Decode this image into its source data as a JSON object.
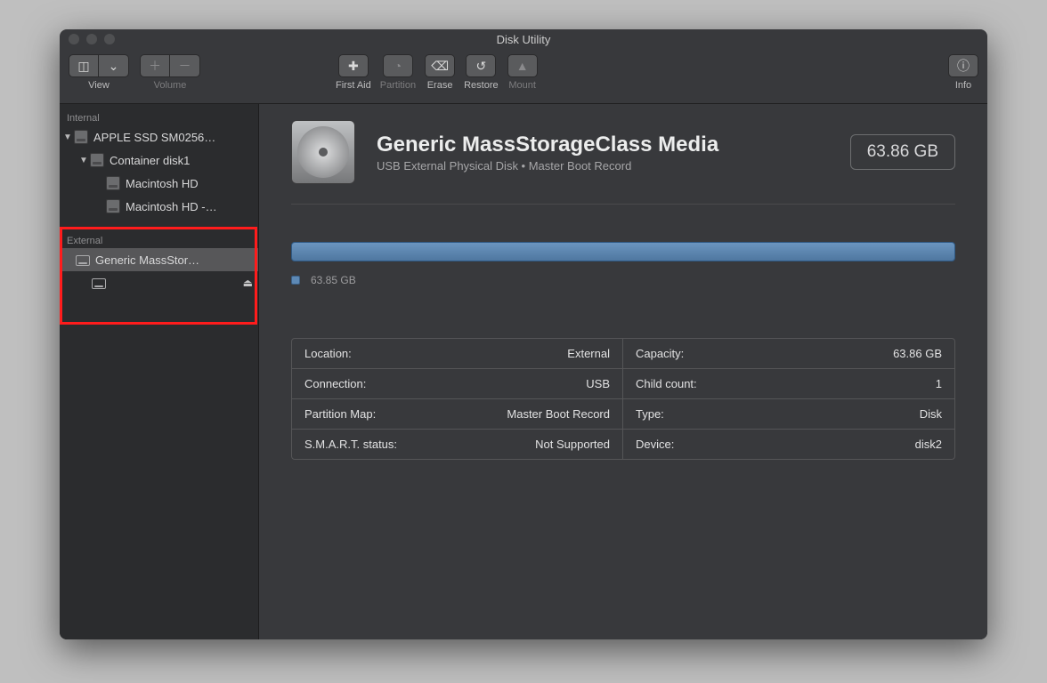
{
  "window_title": "Disk Utility",
  "toolbar": {
    "view": "View",
    "volume": "Volume",
    "first_aid": "First Aid",
    "partition": "Partition",
    "erase": "Erase",
    "restore": "Restore",
    "mount": "Mount",
    "info": "Info"
  },
  "sidebar": {
    "internal_header": "Internal",
    "internal": {
      "disk": "APPLE SSD SM0256…",
      "container": "Container disk1",
      "vol1": "Macintosh HD",
      "vol2": "Macintosh HD -…"
    },
    "external_header": "External",
    "external": {
      "disk": "Generic MassStor…",
      "vol": ""
    }
  },
  "detail": {
    "title": "Generic MassStorageClass Media",
    "subtitle": "USB External Physical Disk • Master Boot Record",
    "capacity_pill": "63.86 GB",
    "legend_size": "63.85 GB"
  },
  "info": {
    "left": [
      {
        "k": "Location:",
        "v": "External"
      },
      {
        "k": "Connection:",
        "v": "USB"
      },
      {
        "k": "Partition Map:",
        "v": "Master Boot Record"
      },
      {
        "k": "S.M.A.R.T. status:",
        "v": "Not Supported"
      }
    ],
    "right": [
      {
        "k": "Capacity:",
        "v": "63.86 GB"
      },
      {
        "k": "Child count:",
        "v": "1"
      },
      {
        "k": "Type:",
        "v": "Disk"
      },
      {
        "k": "Device:",
        "v": "disk2"
      }
    ]
  }
}
